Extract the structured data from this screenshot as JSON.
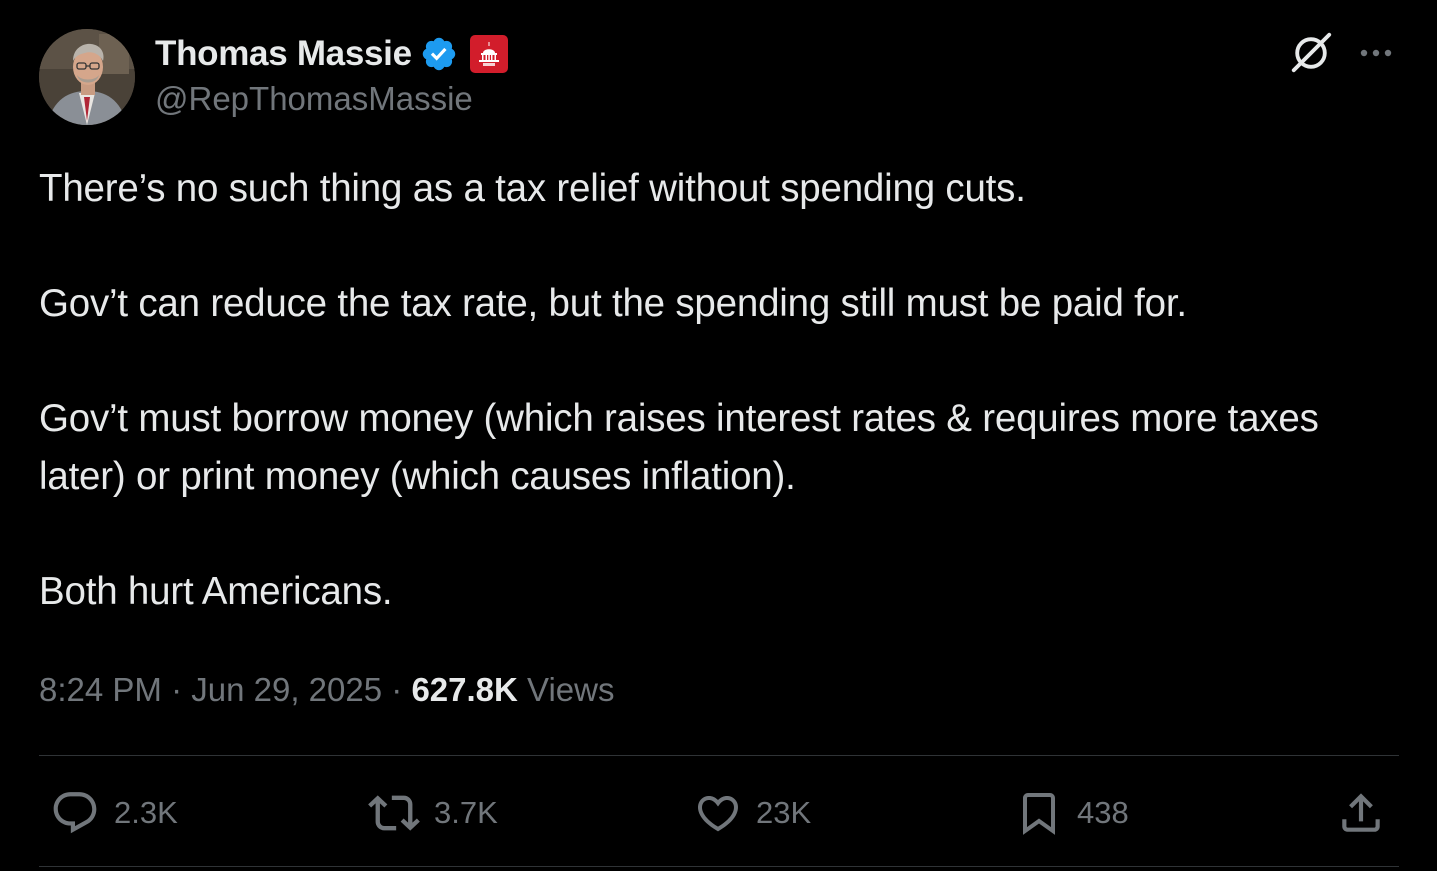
{
  "author": {
    "display_name": "Thomas Massie",
    "handle": "@RepThomasMassie",
    "avatar_alt": "Thomas Massie profile photo",
    "verified_color": "#1d9bf0",
    "affiliate_badge_color": "#d21d2b"
  },
  "header_icons": [
    "verified-icon",
    "capitol-affiliate-badge",
    "grok-icon",
    "more-icon"
  ],
  "tweet": {
    "paragraphs": [
      "There’s no such thing as a tax relief without spending cuts.",
      "Gov’t can reduce the tax rate, but the spending still must be paid for.",
      "Gov’t must borrow money (which raises interest rates & requires more taxes later) or print money (which causes inflation).",
      "Both hurt Americans."
    ]
  },
  "meta": {
    "time": "8:24 PM",
    "separator": "·",
    "date": "Jun 29, 2025",
    "views_count": "627.8K",
    "views_label": "Views"
  },
  "actions": {
    "replies": "2.3K",
    "reposts": "3.7K",
    "likes": "23K",
    "bookmarks": "438"
  },
  "colors": {
    "background": "#000000",
    "text_primary": "#e7e9ea",
    "text_secondary": "#71767b",
    "divider": "#2f3336"
  }
}
